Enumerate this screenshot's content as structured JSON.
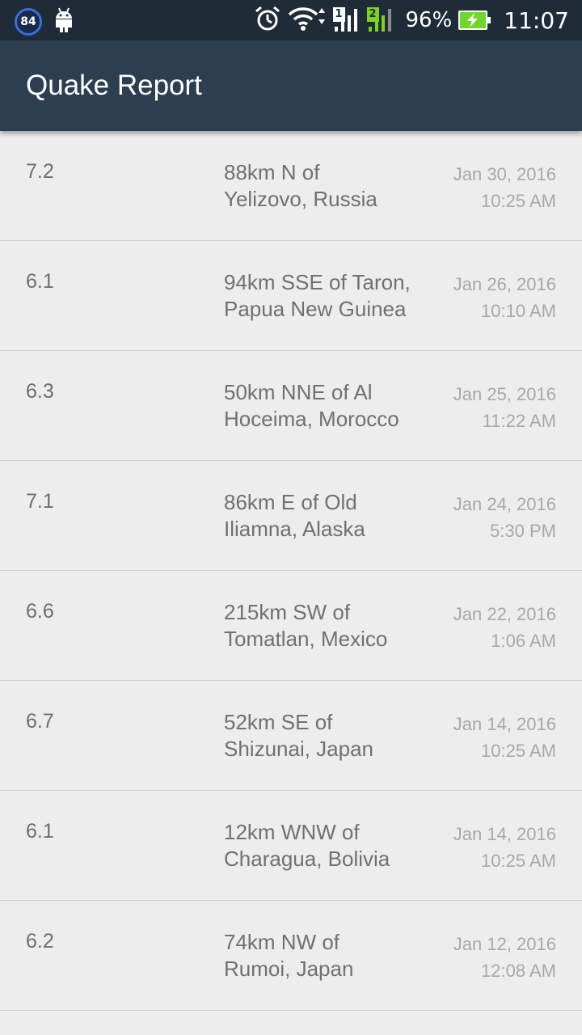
{
  "status_bar": {
    "badge": "84",
    "sim1": "1",
    "sim2": "2",
    "battery_pct": "96%",
    "time": "11:07",
    "icons": [
      "android-icon",
      "alarm-icon",
      "wifi-icon",
      "signal-icon",
      "battery-charging-icon"
    ]
  },
  "app_bar": {
    "title": "Quake Report"
  },
  "earthquakes": [
    {
      "magnitude": "7.2",
      "loc1": "88km N of",
      "loc2": "Yelizovo, Russia",
      "date": "Jan 30, 2016",
      "time": "10:25 AM"
    },
    {
      "magnitude": "6.1",
      "loc1": "94km SSE of Taron,",
      "loc2": "Papua New Guinea",
      "date": "Jan 26, 2016",
      "time": "10:10 AM"
    },
    {
      "magnitude": "6.3",
      "loc1": "50km NNE of Al",
      "loc2": "Hoceima, Morocco",
      "date": "Jan 25, 2016",
      "time": "11:22 AM"
    },
    {
      "magnitude": "7.1",
      "loc1": "86km E of Old",
      "loc2": "Iliamna, Alaska",
      "date": "Jan 24, 2016",
      "time": "5:30 PM"
    },
    {
      "magnitude": "6.6",
      "loc1": "215km SW of",
      "loc2": "Tomatlan, Mexico",
      "date": "Jan 22, 2016",
      "time": "1:06 AM"
    },
    {
      "magnitude": "6.7",
      "loc1": "52km SE of",
      "loc2": "Shizunai, Japan",
      "date": "Jan 14, 2016",
      "time": "10:25 AM"
    },
    {
      "magnitude": "6.1",
      "loc1": "12km WNW of",
      "loc2": "Charagua, Bolivia",
      "date": "Jan 14, 2016",
      "time": "10:25 AM"
    },
    {
      "magnitude": "6.2",
      "loc1": "74km NW of",
      "loc2": "Rumoi, Japan",
      "date": "Jan 12, 2016",
      "time": "12:08 AM"
    }
  ]
}
